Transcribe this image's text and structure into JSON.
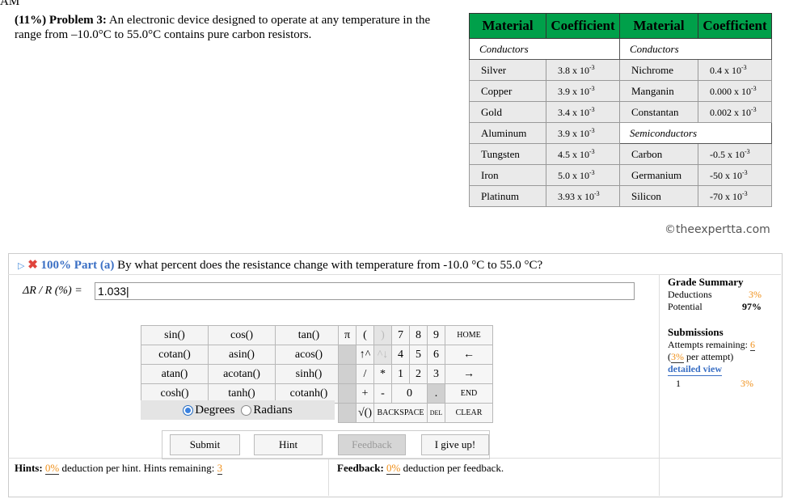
{
  "timestamp_fragment": "AM",
  "problem": {
    "weight": "(11%)",
    "label": "Problem 3:",
    "text": "An electronic device designed to operate at any temperature in the range from –10.0°C to 55.0°C contains pure carbon resistors."
  },
  "coef_table": {
    "headers": [
      "Material",
      "Coefficient",
      "Material",
      "Coefficient"
    ],
    "left_section": "Conductors",
    "right_section_top": "Conductors",
    "right_section_mid": "Semiconductors",
    "left_rows": [
      {
        "material": "Silver",
        "coef": "3.8 x 10",
        "exp": "-3"
      },
      {
        "material": "Copper",
        "coef": "3.9 x 10",
        "exp": "-3"
      },
      {
        "material": "Gold",
        "coef": "3.4 x 10",
        "exp": "-3"
      },
      {
        "material": "Aluminum",
        "coef": "3.9 x 10",
        "exp": "-3"
      },
      {
        "material": "Tungsten",
        "coef": "4.5 x 10",
        "exp": "-3"
      },
      {
        "material": "Iron",
        "coef": "5.0 x 10",
        "exp": "-3"
      },
      {
        "material": "Platinum",
        "coef": "3.93 x 10",
        "exp": "-3"
      }
    ],
    "right_rows_top": [
      {
        "material": "Nichrome",
        "coef": "0.4 x 10",
        "exp": "-3"
      },
      {
        "material": "Manganin",
        "coef": "0.000 x 10",
        "exp": "-3"
      },
      {
        "material": "Constantan",
        "coef": "0.002 x 10",
        "exp": "-3"
      }
    ],
    "right_rows_bottom": [
      {
        "material": "Carbon",
        "coef": "-0.5 x 10",
        "exp": "-3"
      },
      {
        "material": "Germanium",
        "coef": "-50 x 10",
        "exp": "-3"
      },
      {
        "material": "Silicon",
        "coef": "-70 x 10",
        "exp": "-3"
      }
    ],
    "copyright": "©theexpertta.com"
  },
  "part": {
    "score": "100%",
    "label": "Part (a)",
    "question": "By what percent does the resistance change with temperature from -10.0 °C to 55.0 °C?"
  },
  "answer": {
    "label": "ΔR / R (%) =",
    "value": "1.033|"
  },
  "calculator": {
    "func_rows": [
      [
        "sin()",
        "cos()",
        "tan()"
      ],
      [
        "cotan()",
        "asin()",
        "acos()"
      ],
      [
        "atan()",
        "acotan()",
        "sinh()"
      ],
      [
        "cosh()",
        "tanh()",
        "cotanh()"
      ]
    ],
    "degrees": "Degrees",
    "radians": "Radians",
    "pi": "π",
    "lparen": "(",
    "rparen": ")",
    "up": "↑^",
    "down": "^↓",
    "slash": "/",
    "star": "*",
    "plus": "+",
    "minus": "-",
    "sqrt": "√()",
    "digits_row1": [
      "7",
      "8",
      "9"
    ],
    "digits_row2": [
      "4",
      "5",
      "6"
    ],
    "digits_row3": [
      "1",
      "2",
      "3"
    ],
    "zero": "0",
    "dot": ".",
    "home": "HOME",
    "left_arrow": "←",
    "right_arrow": "→",
    "end": "END",
    "backspace": "BACKSPACE",
    "del": "DEL",
    "clear": "CLEAR"
  },
  "buttons": {
    "submit": "Submit",
    "hint": "Hint",
    "feedback": "Feedback",
    "give_up": "I give up!"
  },
  "hints": {
    "label": "Hints:",
    "deduction": "0%",
    "mid": "deduction per hint. Hints remaining:",
    "remaining": "3"
  },
  "feedback": {
    "label": "Feedback:",
    "deduction": "0%",
    "tail": "deduction per feedback."
  },
  "grade_summary": {
    "title": "Grade Summary",
    "deductions_label": "Deductions",
    "deductions_value": "3%",
    "potential_label": "Potential",
    "potential_value": "97%"
  },
  "submissions": {
    "title": "Submissions",
    "attempts_label": "Attempts remaining:",
    "attempts_value": "6",
    "per_attempt_pct": "3%",
    "per_attempt_text": "per attempt)",
    "detail_link": "detailed view",
    "row_index": "1",
    "row_value": "3%"
  },
  "colors": {
    "table_header": "#00a04a",
    "accent_orange": "#f0901a",
    "link_blue": "#3a6fc4",
    "error_red": "#e0443c"
  }
}
